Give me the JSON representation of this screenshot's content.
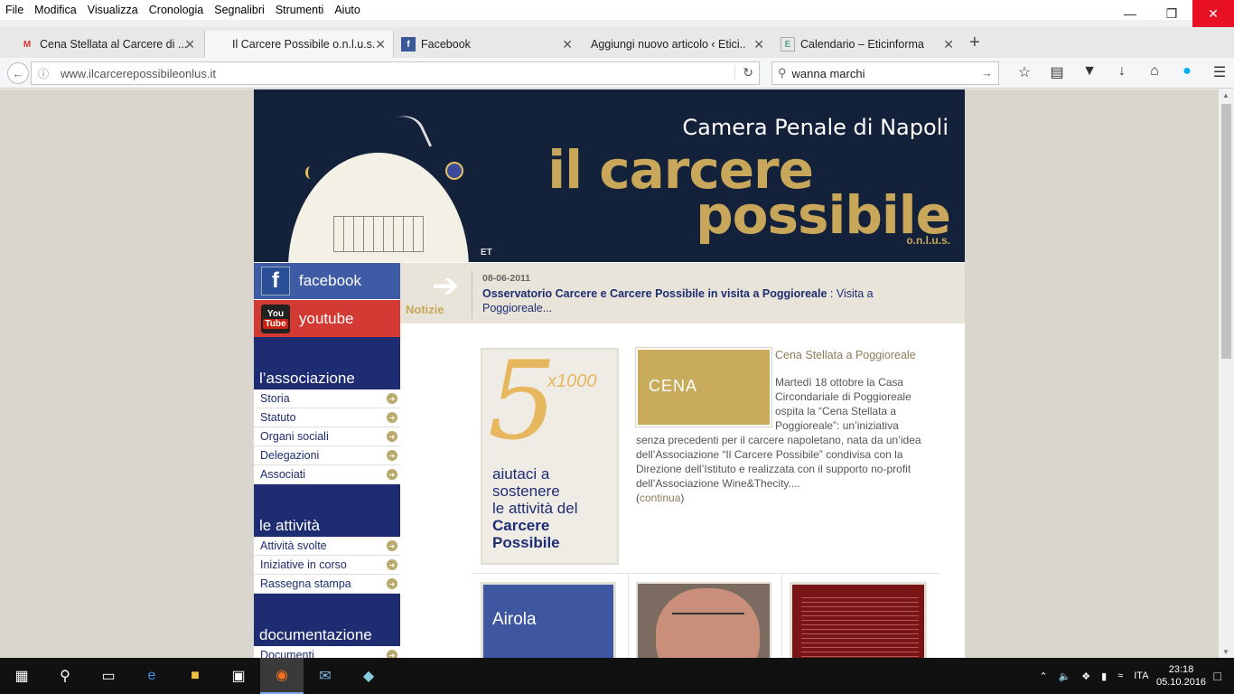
{
  "menu": [
    "File",
    "Modifica",
    "Visualizza",
    "Cronologia",
    "Segnalibri",
    "Strumenti",
    "Aiuto"
  ],
  "tabs": [
    {
      "title": "Cena Stellata al Carcere di ...",
      "icon": "gmail-icon"
    },
    {
      "title": "Il Carcere Possibile o.n.l.u.s.",
      "icon": "none"
    },
    {
      "title": "Facebook",
      "icon": "facebook-icon"
    },
    {
      "title": "Aggiungi nuovo articolo ‹ Etici...",
      "icon": "wordpress-icon"
    },
    {
      "title": "Calendario – Eticinforma",
      "icon": "calendar-icon"
    }
  ],
  "nav": {
    "url": "www.ilcarcerepossibileonlus.it",
    "search_value": "wanna marchi"
  },
  "banner": {
    "line1": "Camera Penale di Napoli",
    "line2": "il carcere",
    "line3": "possibile",
    "line4": "o.n.l.u.s.",
    "signature": "ET"
  },
  "social": {
    "facebook": "facebook",
    "youtube": "youtube",
    "youtube_you": "You",
    "youtube_tube": "Tube"
  },
  "sidebar": {
    "sections": [
      {
        "title": "l’associazione",
        "items": [
          "Storia",
          "Statuto",
          "Organi sociali",
          "Delegazioni",
          "Associati"
        ]
      },
      {
        "title": "le attività",
        "items": [
          "Attività svolte",
          "Iniziative in corso",
          "Rassegna stampa"
        ]
      },
      {
        "title": "documentazione",
        "items": [
          "Documenti"
        ]
      }
    ]
  },
  "news": {
    "label": "Notizie",
    "date": "08-06-2011",
    "headline": "Osservatorio Carcere e Carcere Possibile in visita a Poggioreale",
    "summary": ": Visita a Poggioreale..."
  },
  "promo": {
    "big": "5",
    "x1000": "x1000",
    "line1": "aiutaci a",
    "line2": "sostenere",
    "line3": "le attività del",
    "line4": "Carcere",
    "line5": "Possibile"
  },
  "article": {
    "image_label": "CENA",
    "title": "Cena Stellata a Poggioreale",
    "body1": "Martedì 18 ottobre la Casa Circondariale di Poggioreale ospita la “Cena Stellata a Poggioreale”: un’iniziativa",
    "body2": "senza precedenti per il carcere napoletano, nata da un’idea dell’Associazione “Il Carcere Possibile” condivisa con la Direzione dell’Istituto e realizzata con il supporto no-profit dell’Associazione Wine&Thecity....",
    "more_open": "(",
    "more": "continua",
    "more_close": ")"
  },
  "thumbs": {
    "first": "Airola"
  },
  "taskbar": {
    "lang": "ITA",
    "time": "23:18",
    "date": "05.10.2016"
  },
  "colors": {
    "brand_blue": "#1e2d72",
    "gold": "#c8a75a",
    "banner_bg": "#14213a",
    "facebook": "#3f5ba6",
    "youtube": "#d23a33"
  }
}
